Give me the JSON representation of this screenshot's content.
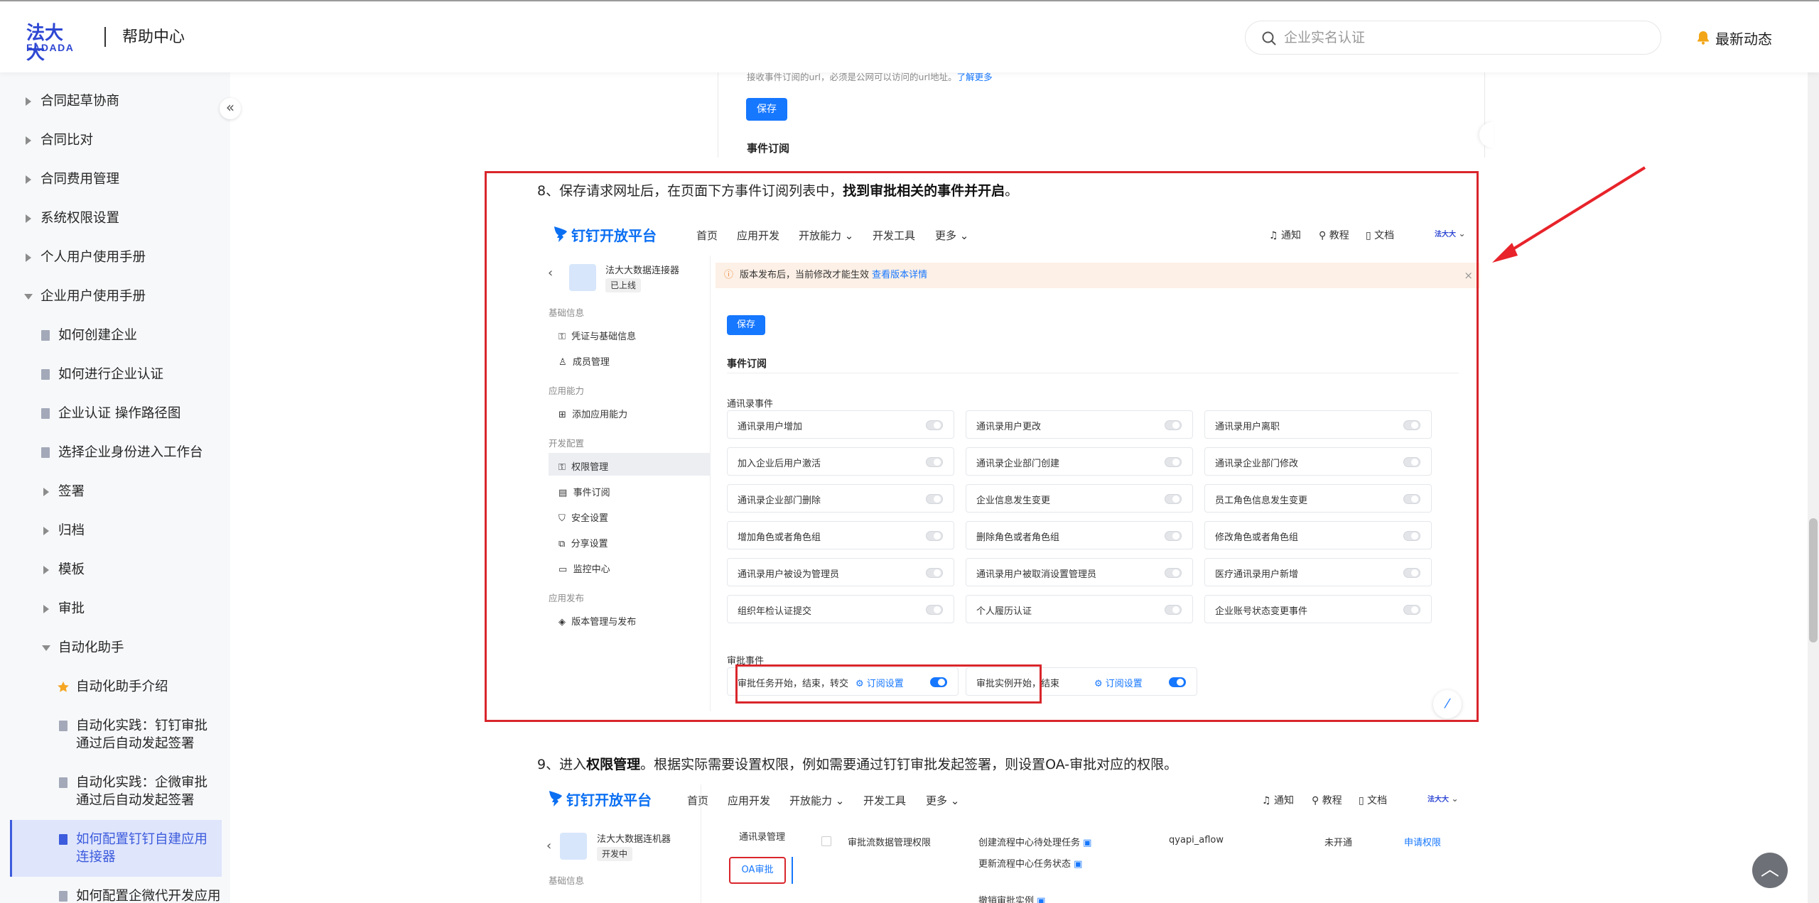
{
  "header": {
    "logo_cn": "法大大",
    "logo_en": "FADADA",
    "title": "帮助中心",
    "search_placeholder": "企业实名认证",
    "news_label": "最新动态"
  },
  "sidebar": {
    "collapse_glyph": "«",
    "items": [
      {
        "label": "合同起草协商"
      },
      {
        "label": "合同比对"
      },
      {
        "label": "合同费用管理"
      },
      {
        "label": "系统权限设置"
      },
      {
        "label": "个人用户使用手册"
      },
      {
        "label": "企业用户使用手册"
      },
      {
        "label": "如何创建企业"
      },
      {
        "label": "如何进行企业认证"
      },
      {
        "label": "企业认证 操作路径图"
      },
      {
        "label": "选择企业身份进入工作台"
      },
      {
        "label": "签署"
      },
      {
        "label": "归档"
      },
      {
        "label": "模板"
      },
      {
        "label": "审批"
      },
      {
        "label": "自动化助手"
      },
      {
        "label": "自动化助手介绍"
      },
      {
        "label": "自动化实践：钉钉审批通过后自动发起签署"
      },
      {
        "label": "自动化实践：企微审批通过后自动发起签署"
      },
      {
        "label": "如何配置钉钉自建应用连接器"
      },
      {
        "label": "如何配置企微代开发应用"
      }
    ]
  },
  "top_partial": {
    "hint_text": "接收事件订阅的url，必须是公网可以访问的url地址。",
    "learn_more": "了解更多",
    "save_label": "保存",
    "section_title": "事件订阅"
  },
  "step8": {
    "prefix": "8、保存请求网址后，在页面下方事件订阅列表中，",
    "bold": "找到审批相关的事件并开启",
    "suffix": "。"
  },
  "step9": {
    "prefix": "9、进入",
    "bold": "权限管理",
    "suffix": "。根据实际需要设置权限，例如需要通过钉钉审批发起签署，则设置OA-审批对应的权限。"
  },
  "dingtalk": {
    "logo_text": "钉钉开放平台",
    "nav": [
      "首页",
      "应用开发",
      "开放能力",
      "开发工具",
      "更多"
    ],
    "right": {
      "notify": "通知",
      "tutorial": "教程",
      "docs": "文档",
      "brand": "法大大"
    },
    "app_name": "法大大数据连接器",
    "app_status": "已上线",
    "side_sections": [
      {
        "title": "基础信息",
        "items": [
          "凭证与基础信息",
          "成员管理"
        ]
      },
      {
        "title": "应用能力",
        "items": [
          "添加应用能力"
        ]
      },
      {
        "title": "开发配置",
        "items": [
          "权限管理",
          "事件订阅",
          "安全设置",
          "分享设置",
          "监控中心"
        ]
      },
      {
        "title": "应用发布",
        "items": [
          "版本管理与发布"
        ]
      }
    ],
    "banner_text": "版本发布后，当前修改才能生效",
    "banner_link": "查看版本详情",
    "save_label": "保存",
    "section_title": "事件订阅",
    "address_book_title": "通讯录事件",
    "address_book_events": [
      "通讯录用户增加",
      "通讯录用户更改",
      "通讯录用户离职",
      "加入企业后用户激活",
      "通讯录企业部门创建",
      "通讯录企业部门修改",
      "通讯录企业部门删除",
      "企业信息发生变更",
      "员工角色信息发生变更",
      "增加角色或者角色组",
      "删除角色或者角色组",
      "修改角色或者角色组",
      "通讯录用户被设为管理员",
      "通讯录用户被取消设置管理员",
      "医疗通讯录用户新增",
      "组织年检认证提交",
      "个人履历认证",
      "企业账号状态变更事件"
    ],
    "approval_title": "审批事件",
    "approval_events": [
      {
        "label": "审批任务开始，结束，转交",
        "link": "订阅设置",
        "enabled": true
      },
      {
        "label": "审批实例开始，结束",
        "link": "订阅设置",
        "enabled": true
      }
    ]
  },
  "dingtalk2": {
    "logo_text": "钉钉开放平台",
    "nav": [
      "首页",
      "应用开发",
      "开放能力",
      "开发工具",
      "更多"
    ],
    "right": {
      "notify": "通知",
      "tutorial": "教程",
      "docs": "文档",
      "brand": "法大大"
    },
    "app_name": "法大大数据连机器",
    "app_status": "开发中",
    "side_label": "基础信息",
    "tabs": [
      "通讯录管理",
      "OA审批"
    ],
    "row": {
      "perm": "审批流数据管理权限",
      "api1": "创建流程中心待处理任务",
      "api2": "更新流程中心任务状态",
      "api3": "撤销审批实例",
      "code": "qyapi_aflow",
      "status": "未开通",
      "action": "申请权限"
    }
  },
  "colors": {
    "brand": "#2e47d3",
    "accent_blue": "#1677ff",
    "highlight_red": "#d9262c",
    "active_bg": "#dfe5fb"
  }
}
